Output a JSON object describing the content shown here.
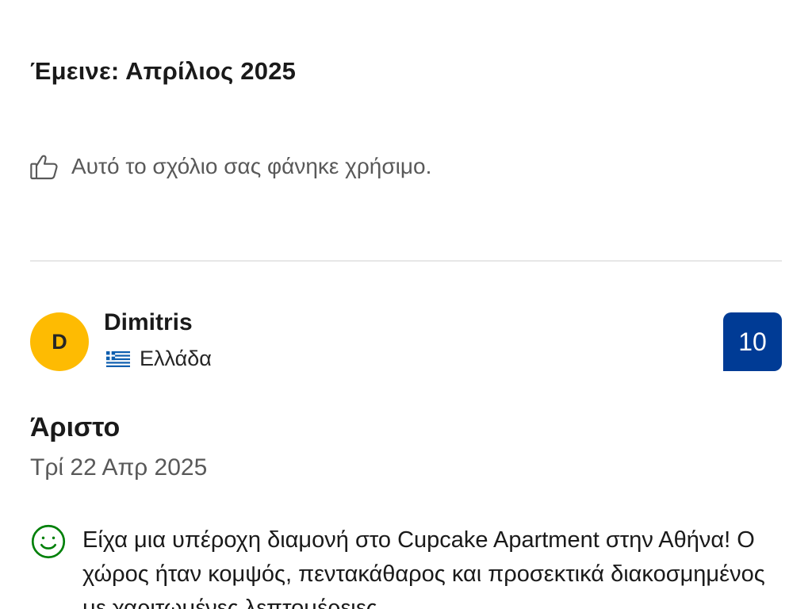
{
  "previous_review": {
    "stay_label": "Έμεινε: Απρίλιος 2025",
    "helpful_text": "Αυτό το σχόλιο σας φάνηκε χρήσιμο.",
    "helpful_icon": "thumbs-up-icon"
  },
  "review": {
    "avatar_initial": "D",
    "avatar_color": "#febb02",
    "reviewer_name": "Dimitris",
    "country_flag_icon": "greece-flag-icon",
    "country": "Ελλάδα",
    "score": "10",
    "score_color": "#003b95",
    "title": "Άριστο",
    "date": "Τρί 22 Απρ 2025",
    "positive_icon": "smiley-icon",
    "positive_color": "#008009",
    "positive_text": "Είχα μια υπέροχη διαμονή στο Cupcake Apartment στην Αθήνα! Ο χώρος ήταν κομψός, πεντακάθαρος και προσεκτικά διακοσμημένος με χαριτωμένες λεπτομέρειες"
  }
}
